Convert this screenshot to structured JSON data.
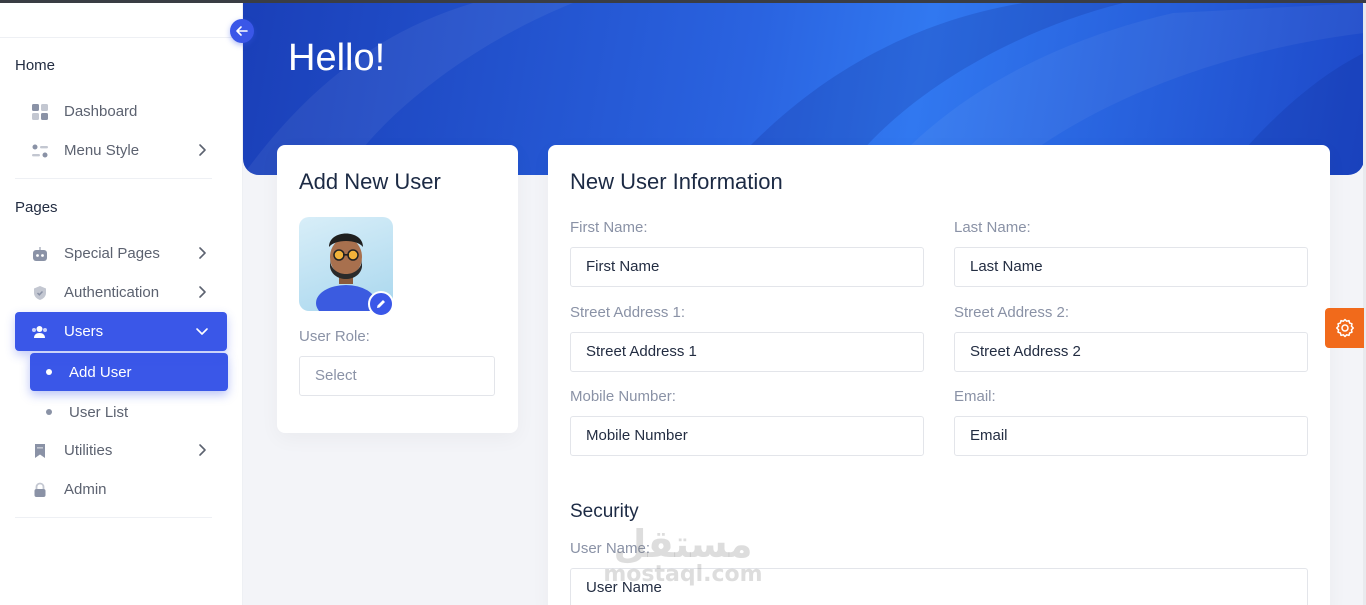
{
  "sidebar": {
    "sections": [
      {
        "title": "Home"
      },
      {
        "title": "Pages"
      }
    ],
    "home_items": [
      {
        "label": "Dashboard",
        "icon": "grid-icon"
      },
      {
        "label": "Menu Style",
        "icon": "sliders-icon"
      }
    ],
    "page_items": [
      {
        "label": "Special Pages",
        "icon": "robot-icon"
      },
      {
        "label": "Authentication",
        "icon": "shield-icon"
      },
      {
        "label": "Users",
        "icon": "users-icon"
      }
    ],
    "users_sub": [
      {
        "label": "Add User"
      },
      {
        "label": "User List"
      }
    ],
    "more_items": [
      {
        "label": "Utilities",
        "icon": "bookmark-icon"
      },
      {
        "label": "Admin",
        "icon": "lock-icon"
      }
    ]
  },
  "header": {
    "greeting": "Hello!"
  },
  "add_user_card": {
    "title": "Add New User",
    "role_label": "User Role:",
    "role_value": "Select"
  },
  "info_card": {
    "title": "New User Information",
    "first_name": {
      "label": "First Name:",
      "placeholder": "First Name"
    },
    "last_name": {
      "label": "Last Name:",
      "placeholder": "Last Name"
    },
    "street1": {
      "label": "Street Address 1:",
      "placeholder": "Street Address 1"
    },
    "street2": {
      "label": "Street Address 2:",
      "placeholder": "Street Address 2"
    },
    "mobile": {
      "label": "Mobile Number:",
      "placeholder": "Mobile Number"
    },
    "email": {
      "label": "Email:",
      "placeholder": "Email"
    },
    "security_title": "Security",
    "username": {
      "label": "User Name:",
      "placeholder": "User Name"
    }
  },
  "watermark": {
    "arabic": "مستقل",
    "latin": "mostaql.com"
  },
  "colors": {
    "primary": "#3a57e8",
    "settings": "#f16a1b",
    "banner": "#2a63e0"
  }
}
